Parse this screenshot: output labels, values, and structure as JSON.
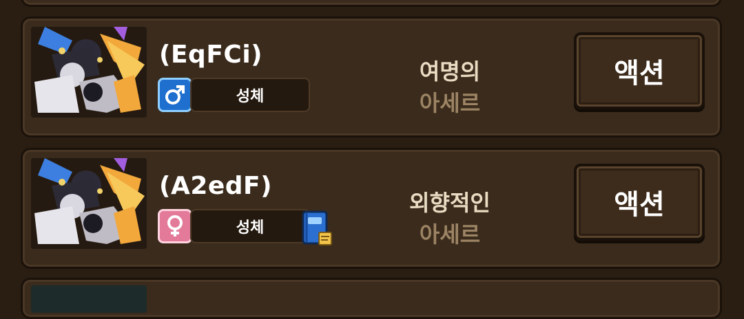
{
  "cards": [
    {
      "name": "(EqFCi)",
      "gender": "male",
      "gender_symbol": "♂",
      "stage": "성체",
      "has_book": false,
      "trait_line1": "여명의",
      "trait_line2": "아세르",
      "action_label": "액션"
    },
    {
      "name": "(A2edF)",
      "gender": "female",
      "gender_symbol": "♀",
      "stage": "성체",
      "has_book": true,
      "trait_line1": "외향적인",
      "trait_line2": "아세르",
      "action_label": "액션"
    }
  ],
  "colors": {
    "male": "#1f6fcf",
    "female": "#e37a9a",
    "panel": "#3a2b1c",
    "background": "#2a1e13"
  },
  "icons": {
    "male": "male-gender-icon",
    "female": "female-gender-icon",
    "book": "blue-book-icon"
  }
}
